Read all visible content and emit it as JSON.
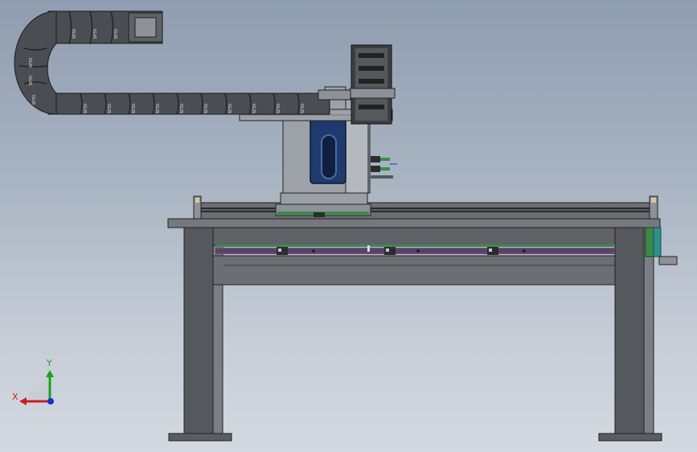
{
  "view": {
    "title": "",
    "background_top": "#8f9db0",
    "background_bottom": "#d4d9e1"
  },
  "model": {
    "frame_color": "#55585c",
    "frame_edge": "#222222",
    "beam_color": "#6b6e72",
    "carriage_color": "#8d9298",
    "motor_color": "#1e3a6e",
    "rail_green": "#3c8a4a",
    "rail_purple": "#7a3d8c",
    "cable_chain_color": "#4a4d51",
    "accent_teal": "#2f8f8a"
  },
  "cable_chain": {
    "link_label": "IGUS"
  },
  "triad": {
    "x_label": "X",
    "y_label": "Y",
    "x_color": "#d11c1c",
    "y_color": "#1aa11a",
    "z_color": "#1c2fd1"
  }
}
